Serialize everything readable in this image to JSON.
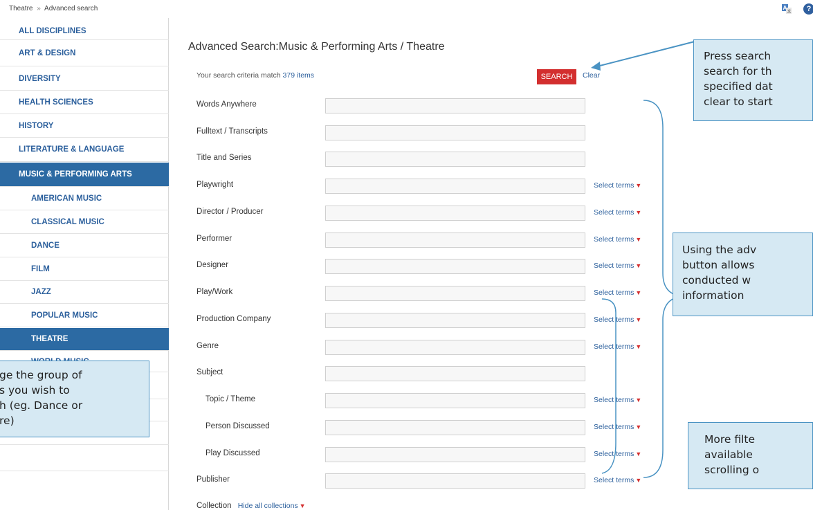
{
  "breadcrumb": {
    "parent": "Theatre",
    "separator": "»",
    "current": "Advanced search"
  },
  "header": {
    "help_glyph": "?"
  },
  "sidebar": {
    "items": [
      {
        "label": "ALL DISCIPLINES"
      },
      {
        "label": "ART & DESIGN"
      },
      {
        "label": "DIVERSITY"
      },
      {
        "label": "HEALTH SCIENCES"
      },
      {
        "label": "HISTORY"
      },
      {
        "label": "LITERATURE & LANGUAGE"
      },
      {
        "label": "MUSIC & PERFORMING ARTS",
        "active": true
      },
      {
        "label": "AMERICAN MUSIC"
      },
      {
        "label": "CLASSICAL MUSIC"
      },
      {
        "label": "DANCE"
      },
      {
        "label": "FILM"
      },
      {
        "label": "JAZZ"
      },
      {
        "label": "POPULAR MUSIC"
      },
      {
        "label": "THEATRE",
        "active": true
      },
      {
        "label": "WORLD MUSIC"
      }
    ]
  },
  "main": {
    "title": "Advanced Search:Music & Performing Arts / Theatre",
    "criteria_prefix": "Your search criteria match",
    "criteria_count": "379 items",
    "search_label": "SEARCH",
    "clear_label": "Clear",
    "select_terms_label": "Select terms",
    "arrow_glyph": "▼",
    "fields": [
      {
        "label": "Words Anywhere"
      },
      {
        "label": "Fulltext / Transcripts"
      },
      {
        "label": "Title and Series"
      },
      {
        "label": "Playwright"
      },
      {
        "label": "Director / Producer"
      },
      {
        "label": "Performer"
      },
      {
        "label": "Designer"
      },
      {
        "label": "Play/Work"
      },
      {
        "label": "Production Company"
      },
      {
        "label": "Genre"
      },
      {
        "label": "Subject"
      },
      {
        "label": "Topic / Theme"
      },
      {
        "label": "Person Discussed"
      },
      {
        "label": "Play Discussed"
      },
      {
        "label": "Publisher"
      }
    ],
    "collection_label": "Collection",
    "hide_collections_label": "Hide all collections"
  },
  "callouts": {
    "search_tip": [
      "Press search",
      "search for th",
      "specified dat",
      "clear to start"
    ],
    "advanced_tip": [
      "Using the adv",
      "button allows",
      "conducted w",
      "information"
    ],
    "filters_tip": [
      "More filte",
      "available",
      "scrolling o"
    ],
    "group_tip": [
      "ge the group of",
      "s you wish to",
      "h (eg. Dance or",
      "re)"
    ]
  },
  "colors": {
    "brand_blue": "#2c6aa3",
    "link_blue": "#2b5f9c",
    "search_red": "#d32f2f",
    "callout_fill": "#d6e9f3",
    "callout_border": "#4a93c3"
  }
}
